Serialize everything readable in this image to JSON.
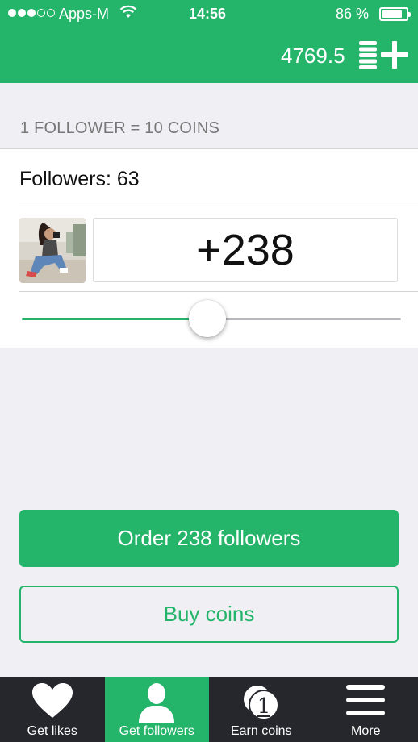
{
  "status_bar": {
    "carrier": "Apps-M",
    "time": "14:56",
    "battery": "86 %"
  },
  "header": {
    "balance": "4769.5",
    "coins_add_icon": "coins-plus-icon"
  },
  "rate_text": "1 FOLLOWER = 10 COINS",
  "card": {
    "followers_label": "Followers: 63",
    "order_count": "+238",
    "slider": {
      "value": 238,
      "fraction": 0.49
    }
  },
  "buttons": {
    "order_label": "Order 238 followers",
    "buy_label": "Buy coins"
  },
  "tabs": [
    {
      "label": "Get likes",
      "icon": "heart-icon",
      "active": false
    },
    {
      "label": "Get followers",
      "icon": "user-icon",
      "active": true
    },
    {
      "label": "Earn coins",
      "icon": "coin-icon",
      "active": false
    },
    {
      "label": "More",
      "icon": "menu-icon",
      "active": false
    }
  ],
  "colors": {
    "accent": "#24b46a",
    "tabbar": "#25272d",
    "background": "#efeff4"
  }
}
